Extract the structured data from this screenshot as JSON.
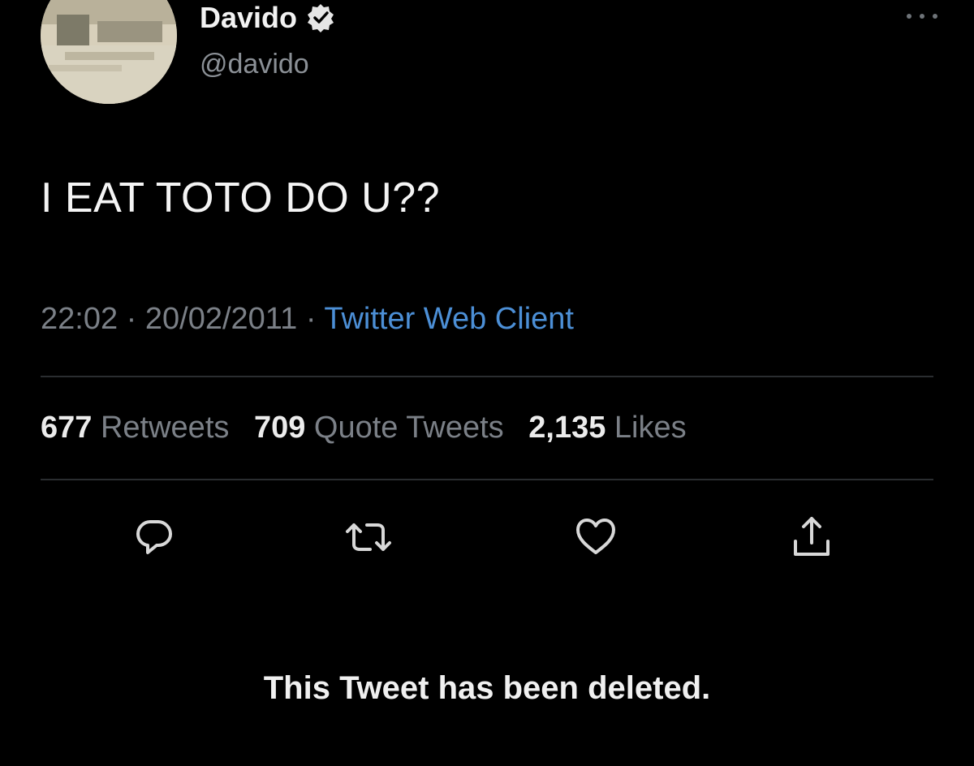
{
  "tweet": {
    "author": {
      "display_name": "Davido",
      "handle": "@davido",
      "verified": true
    },
    "text": "I EAT TOTO DO U??",
    "meta": {
      "time": "22:02",
      "separator": "·",
      "date": "20/02/2011",
      "source": "Twitter Web Client"
    },
    "stats": {
      "retweets_count": "677",
      "retweets_label": "Retweets",
      "quotes_count": "709",
      "quotes_label": "Quote Tweets",
      "likes_count": "2,135",
      "likes_label": "Likes"
    },
    "actions": {
      "reply_icon": "reply-icon",
      "retweet_icon": "retweet-icon",
      "like_icon": "heart-icon",
      "share_icon": "share-icon"
    },
    "deleted_notice": "This Tweet has been deleted."
  },
  "colors": {
    "background": "#000000",
    "muted_text": "#7b8087",
    "link": "#4c8fd6",
    "divider": "#2a2d30"
  }
}
